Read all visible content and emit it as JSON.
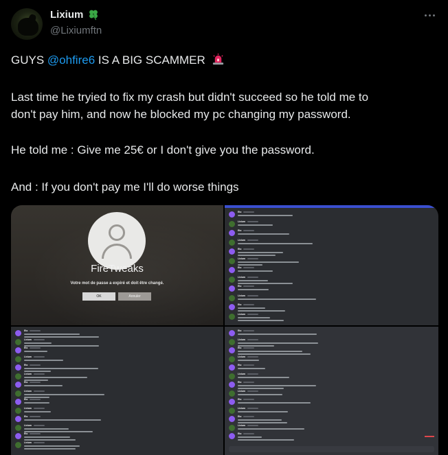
{
  "author": {
    "display_name": "Lixium",
    "handle": "@Lixiumftn",
    "badge_icon": "four-leaf-clover-icon",
    "avatar_icon": "black-dog-avatar"
  },
  "menu": {
    "icon": "more-options-icon"
  },
  "post": {
    "line1_before": "GUYS ",
    "line1_mention": "@ohfire6",
    "line1_after": " IS A BIG SCAMMER",
    "line1_emoji": "siren-icon",
    "line2": "Last time he tryied to fix my crash but didn't succeed so he told me to",
    "line3": "don't pay him, and now he blocked my pc changing my password.",
    "line4": "He told me : Give me 25€ or I don't give you the password.",
    "line5": "And : If you don't pay me I'll do worse things"
  },
  "media": {
    "lock_screen": {
      "username": "FireTweaks",
      "message": "Votre mot de passe a expiré et doit être changé.",
      "ok_label": "OK",
      "cancel_label": "Annuler"
    },
    "chat_participants": [
      "Eto",
      "Lixium"
    ]
  },
  "colors": {
    "background": "#000000",
    "text": "#e7e9ea",
    "muted": "#71767b",
    "mention": "#1d9bf0",
    "discord_bg": "#2b2d31",
    "discord_accent": "#3a4fcf"
  }
}
